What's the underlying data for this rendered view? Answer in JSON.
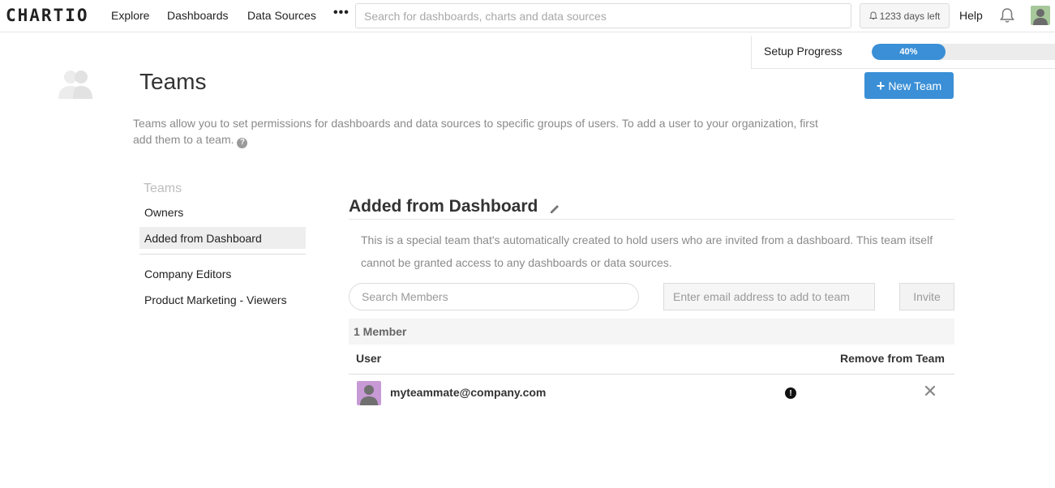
{
  "app": {
    "logo": "CHARTIO"
  },
  "nav": {
    "items": [
      {
        "label": "Explore"
      },
      {
        "label": "Dashboards"
      },
      {
        "label": "Data Sources"
      }
    ],
    "more_label": "•••",
    "search_placeholder": "Search for dashboards, charts and data sources",
    "days_left": "1233 days left",
    "help": "Help",
    "bell_icon": "bell-icon",
    "avatar_color": "#a7c89a"
  },
  "setup": {
    "label": "Setup Progress",
    "progress_percent": 40,
    "progress_text": "40%"
  },
  "page": {
    "title": "Teams",
    "new_team_label": "New Team",
    "description": "Teams allow you to set permissions for dashboards and data sources to specific groups of users. To add a user to your organization, first add them to a team."
  },
  "sidebar": {
    "heading": "Teams",
    "items": [
      {
        "label": "Owners",
        "active": false
      },
      {
        "label": "Added from Dashboard",
        "active": true
      },
      {
        "label": "Company Editors",
        "active": false
      },
      {
        "label": "Product Marketing - Viewers",
        "active": false
      }
    ]
  },
  "team": {
    "title": "Added from Dashboard",
    "description": "This is a special team that's automatically created to hold users who are invited from a dashboard. This team itself cannot be granted access to any dashboards or data sources.",
    "search_placeholder": "Search Members",
    "email_placeholder": "Enter email address to add to team",
    "invite_label": "Invite",
    "member_count": "1 Member",
    "columns": {
      "user": "User",
      "remove": "Remove from Team"
    },
    "members": [
      {
        "email": "myteammate@company.com",
        "avatar_color": "#c79ad6"
      }
    ]
  },
  "colors": {
    "accent": "#3a8fd6"
  }
}
